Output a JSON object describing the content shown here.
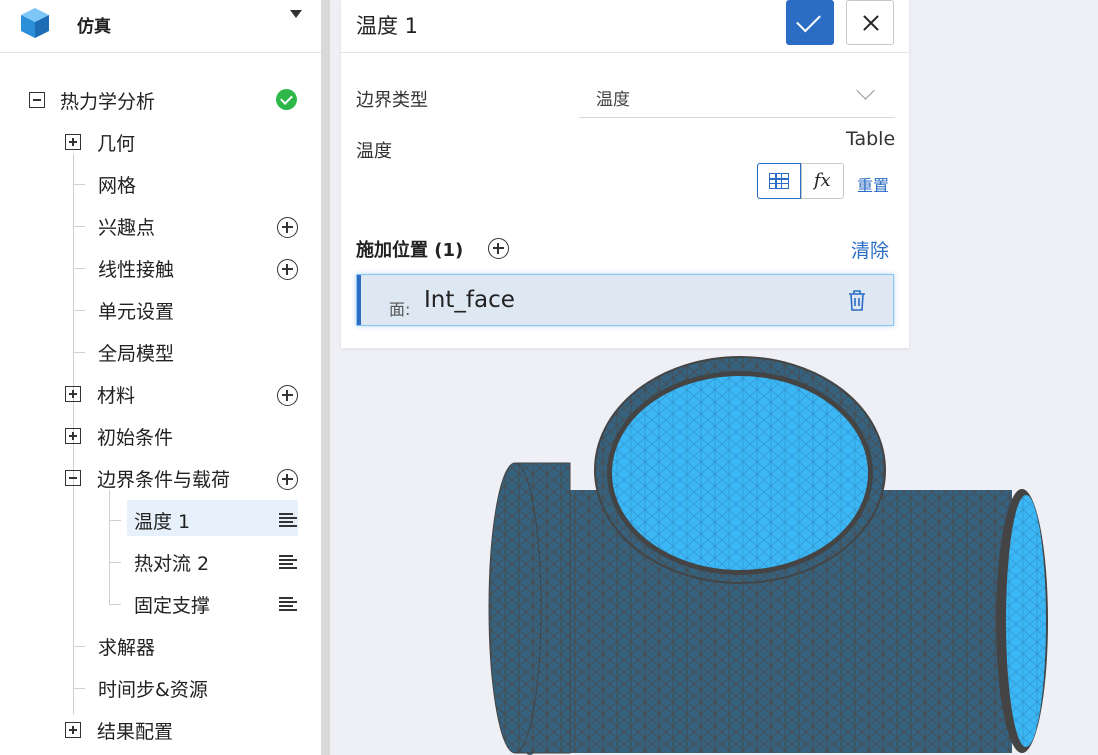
{
  "app": {
    "title": "仿真"
  },
  "tree": {
    "root_label": "热力学分析",
    "items": [
      {
        "label": "几何"
      },
      {
        "label": "网格"
      },
      {
        "label": "兴趣点"
      },
      {
        "label": "线性接触"
      },
      {
        "label": "单元设置"
      },
      {
        "label": "全局模型"
      },
      {
        "label": "材料"
      },
      {
        "label": "初始条件"
      },
      {
        "label": "边界条件与载荷"
      },
      {
        "label": "温度 1"
      },
      {
        "label": "热对流 2"
      },
      {
        "label": "固定支撑"
      },
      {
        "label": "求解器"
      },
      {
        "label": "时间步&资源"
      },
      {
        "label": "结果配置"
      }
    ]
  },
  "panel": {
    "title": "温度 1",
    "boundary_type_label": "边界类型",
    "boundary_type_value": "温度",
    "temperature_label": "温度",
    "temperature_mode": "Table",
    "fx_label": "fx",
    "reset_label": "重置",
    "location_title": "施加位置 (1)",
    "clear_label": "清除",
    "location": {
      "prefix": "面:",
      "name": "Int_face"
    }
  },
  "colors": {
    "accent": "#2b6cc4",
    "success": "#2fb84a",
    "mesh_inner": "#3bb6f5",
    "mesh_outer": "#36637f"
  }
}
